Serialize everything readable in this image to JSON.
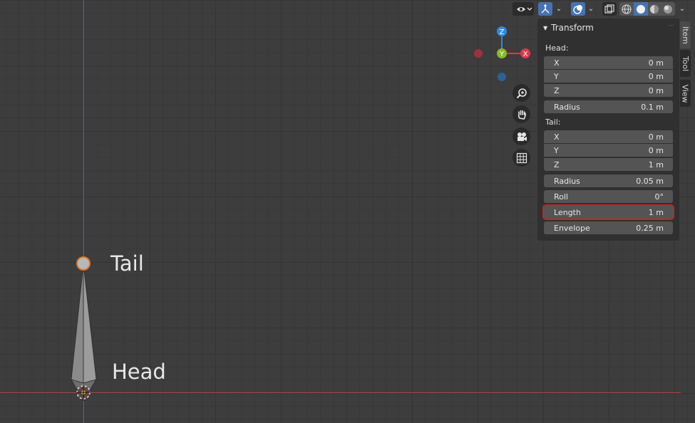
{
  "viewport": {
    "bone": {
      "tail_label": "Tail",
      "head_label": "Head"
    },
    "gizmo": {
      "z_label": "Z",
      "y_label": "Y",
      "x_label": "X",
      "colors": {
        "x": "#e4344f",
        "y": "#8ab92c",
        "z": "#2d8ae4"
      }
    },
    "nav_icons": [
      "zoom-icon",
      "pan-hand-icon",
      "camera-icon",
      "grid-icon"
    ]
  },
  "header": {
    "icons": [
      "visibility-icon",
      "gizmo-icon",
      "overlay-icon",
      "xray-icon",
      "wireframe-shading-icon",
      "solid-shading-icon",
      "material-shading-icon",
      "rendered-shading-icon"
    ]
  },
  "sidebar": {
    "tabs": [
      "Item",
      "Tool",
      "View"
    ],
    "panel_title": "Transform",
    "head": {
      "label": "Head:",
      "x_label": "X",
      "x_value": "0 m",
      "y_label": "Y",
      "y_value": "0 m",
      "z_label": "Z",
      "z_value": "0 m",
      "radius_label": "Radius",
      "radius_value": "0.1 m"
    },
    "tail": {
      "label": "Tail:",
      "x_label": "X",
      "x_value": "0 m",
      "y_label": "Y",
      "y_value": "0 m",
      "z_label": "Z",
      "z_value": "1 m",
      "radius_label": "Radius",
      "radius_value": "0.05 m"
    },
    "roll_label": "Roll",
    "roll_value": "0°",
    "length_label": "Length",
    "length_value": "1 m",
    "envelope_label": "Envelope",
    "envelope_value": "0.25 m"
  }
}
